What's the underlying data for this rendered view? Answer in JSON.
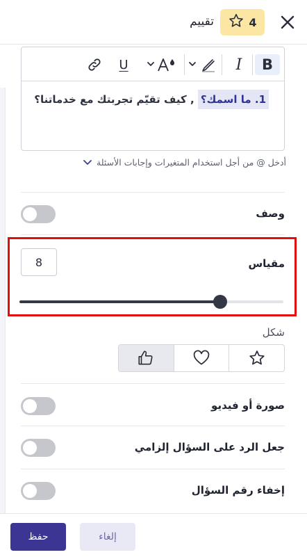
{
  "header": {
    "title": "تقييم",
    "badge_number": "4",
    "badge_icon": "star-outline-icon",
    "close_icon": "close-icon"
  },
  "editor": {
    "toolbar": [
      "bold",
      "italic",
      "highlight-color",
      "font-color",
      "underline",
      "link"
    ],
    "bold_label": "B",
    "italic_label": "I",
    "underline_label": "U",
    "question_highlight": "1. ما اسمك؟",
    "question_rest": " , كيف تقيّم تجربتك مع خدماتنا؟"
  },
  "hint": {
    "text": "أدخل @ من أجل استخدام المتغيرات وإجابات الأسئلة"
  },
  "description": {
    "label": "وصف",
    "enabled": false
  },
  "scale": {
    "label": "مقياس",
    "value": "8",
    "slider_fraction": 0.76
  },
  "shape": {
    "label": "شكل",
    "options": [
      "star",
      "heart",
      "thumbs-up"
    ],
    "selected": "thumbs-up"
  },
  "media": {
    "label": "صورة أو فيديو",
    "enabled": false
  },
  "required": {
    "label": "جعل الرد على السؤال إلزامي",
    "enabled": false
  },
  "hide_number": {
    "label": "إخفاء رقم السؤال",
    "enabled": false
  },
  "footer": {
    "save_label": "حفظ",
    "cancel_label": "إلغاء"
  },
  "colors": {
    "primary": "#3b3593",
    "badge": "#fbe6a3",
    "highlight": "#e10e0e"
  }
}
